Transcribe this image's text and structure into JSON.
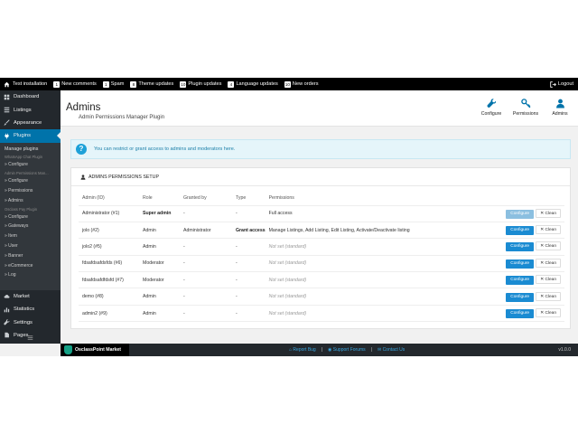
{
  "topbar": {
    "site": "Test installation",
    "items": [
      {
        "count": "1",
        "label": "New comments"
      },
      {
        "count": "1",
        "label": "Spam"
      },
      {
        "count": "8",
        "label": "Theme updates"
      },
      {
        "count": "10",
        "label": "Plugin updates"
      },
      {
        "count": "4",
        "label": "Language updates"
      },
      {
        "count": "10",
        "label": "New orders"
      }
    ],
    "logout": "Logout"
  },
  "sidebar": {
    "items_top": [
      "Dashboard",
      "Listings",
      "Appearance",
      "Plugins"
    ],
    "sub": {
      "manage": "Manage plugins",
      "whatsapp_group": "WhatsApp Chat Plugin",
      "whatsapp_configure": "» Configure",
      "admin_group": "Admin Permissions Man...",
      "admin_configure": "» Configure",
      "admin_permissions": "» Permissions",
      "admin_admins": "» Admins",
      "pay_group": "Osclass Pay Plugin",
      "pay_items": [
        "» Configure",
        "» Gateways",
        "» Item",
        "» User",
        "» Banner",
        "» eCommerce",
        "» Log"
      ]
    },
    "items_bottom": [
      "Market",
      "Statistics",
      "Settings",
      "Pages"
    ]
  },
  "header": {
    "title": "Admins",
    "subtitle": "Admin Permissions Manager Plugin",
    "buttons": [
      "Configure",
      "Permissions",
      "Admins"
    ]
  },
  "notice": "You can restrict or grant access to admins and moderators here.",
  "panel": {
    "title": "Admins permissions setup",
    "columns": [
      "Admin (ID)",
      "Role",
      "Granted by",
      "Type",
      "Permissions"
    ],
    "configure_label": "Configure",
    "clean_label": "Clean",
    "rows": [
      {
        "admin": "Administrator (#1)",
        "role": "Super admin",
        "granted": "-",
        "type": "-",
        "perm": "Full access"
      },
      {
        "admin": "jolo (#2)",
        "role": "Admin",
        "granted": "Administrator",
        "type": "Grant access",
        "perm": "Manage Listings, Add Listing, Edit Listing, Activate/Deactivate listing"
      },
      {
        "admin": "jolo2 (#5)",
        "role": "Admin",
        "granted": "-",
        "type": "-",
        "perm": "Not set (standard)"
      },
      {
        "admin": "fdsafdsafdsfds (#6)",
        "role": "Moderator",
        "granted": "-",
        "type": "-",
        "perm": "Not set (standard)"
      },
      {
        "admin": "fdsafdsafdfdsfd (#7)",
        "role": "Moderator",
        "granted": "-",
        "type": "-",
        "perm": "Not set (standard)"
      },
      {
        "admin": "demo (#8)",
        "role": "Admin",
        "granted": "-",
        "type": "-",
        "perm": "Not set (standard)"
      },
      {
        "admin": "admin2 (#9)",
        "role": "Admin",
        "granted": "-",
        "type": "-",
        "perm": "Not set (standard)"
      }
    ]
  },
  "footer": {
    "brand": "OsclassPoint Market",
    "links": [
      "Report Bug",
      "Support Forums",
      "Contact Us"
    ],
    "version": "v1.0.0"
  }
}
